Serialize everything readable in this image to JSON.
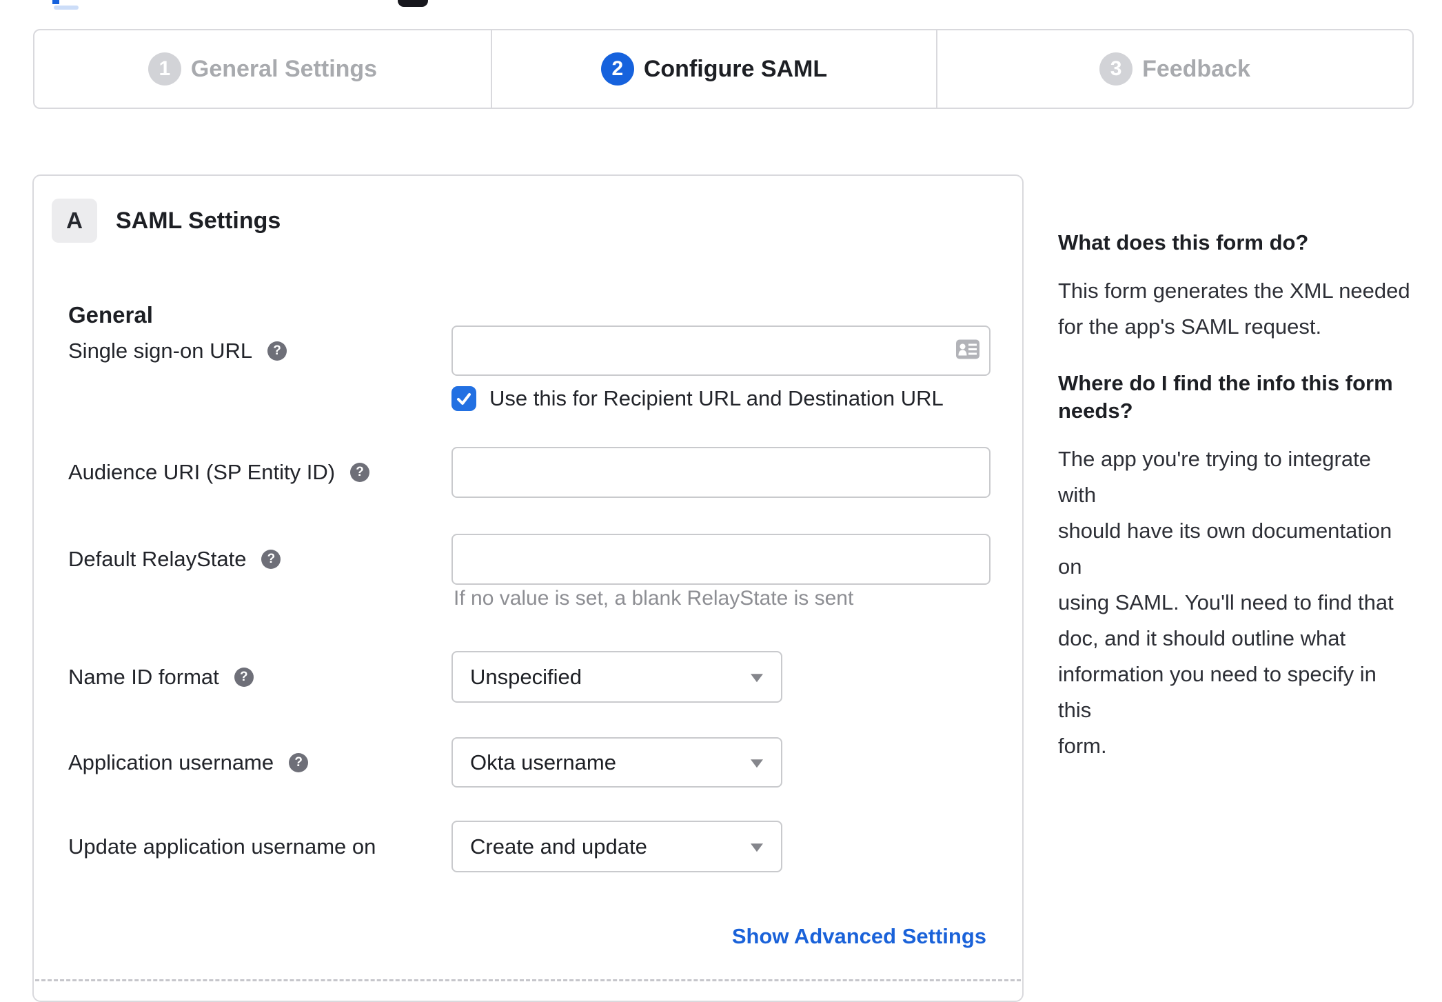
{
  "stepper": {
    "steps": [
      {
        "number": "1",
        "label": "General Settings",
        "state": "inactive"
      },
      {
        "number": "2",
        "label": "Configure SAML",
        "state": "active"
      },
      {
        "number": "3",
        "label": "Feedback",
        "state": "inactive"
      }
    ]
  },
  "panel": {
    "badge": "A",
    "title": "SAML Settings",
    "section": "General",
    "rows": {
      "sso": {
        "label": "Single sign-on URL",
        "value": "",
        "checkbox_label": "Use this for Recipient URL and Destination URL",
        "checkbox_checked": true
      },
      "audience": {
        "label": "Audience URI (SP Entity ID)",
        "value": ""
      },
      "relay": {
        "label": "Default RelayState",
        "value": "",
        "hint": "If no value is set, a blank RelayState is sent"
      },
      "nameid": {
        "label": "Name ID format",
        "value": "Unspecified"
      },
      "appuser": {
        "label": "Application username",
        "value": "Okta username"
      },
      "update": {
        "label": "Update application username on",
        "value": "Create and update"
      }
    },
    "help_icon_glyph": "?",
    "advanced_link": "Show Advanced Settings"
  },
  "help_sidebar": {
    "q1": "What does this form do?",
    "a1": "This form generates the XML needed\nfor the app's SAML request.",
    "q2": "Where do I find the info this form\nneeds?",
    "a2": "The app you're trying to integrate with\nshould have its own documentation on\nusing SAML. You'll need to find that\ndoc, and it should outline what\ninformation you need to specify in this\nform."
  },
  "colors": {
    "accent_blue": "#1662dd",
    "checkbox_blue": "#2270e2",
    "link_blue": "#1a62d9",
    "inactive_gray": "#a8aaae",
    "border_gray": "#d9d9dd"
  }
}
